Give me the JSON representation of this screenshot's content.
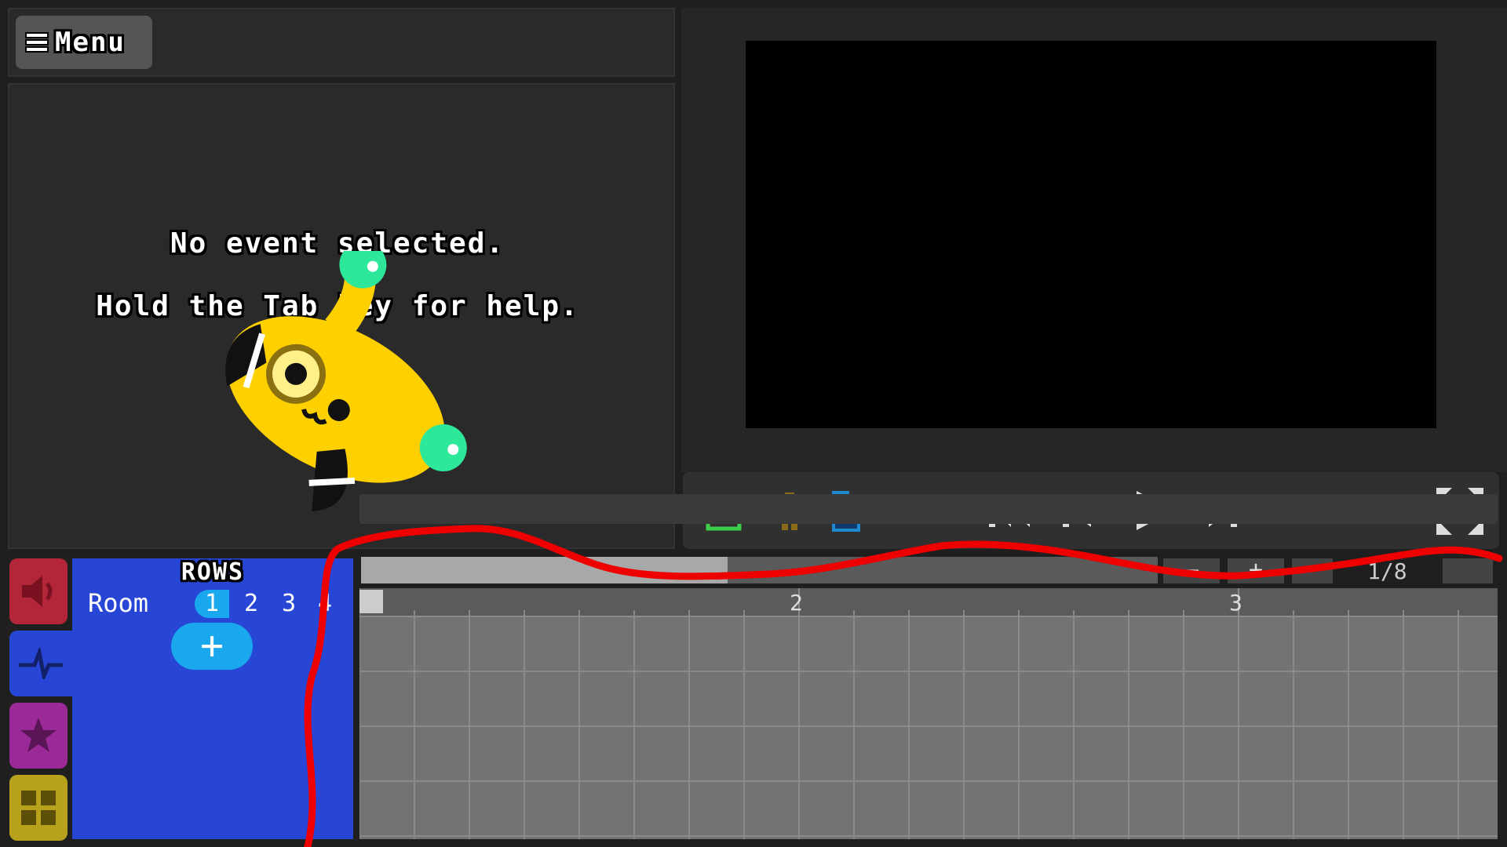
{
  "menu": {
    "label": "Menu"
  },
  "event_panel": {
    "line1": "No event selected.",
    "line2": "Hold the Tab key for help."
  },
  "controls": {
    "buttons": [
      "character-icon",
      "player-icon",
      "room-icon",
      "skip-to-start",
      "step-back",
      "play",
      "step-forward",
      "fullscreen"
    ]
  },
  "timeline": {
    "page_counter": "1/8",
    "bar_labels": [
      "2",
      "3"
    ],
    "progress": 0.46
  },
  "rows": {
    "title": "ROWS",
    "room_label": "Room",
    "rooms": [
      "1",
      "2",
      "3",
      "4"
    ],
    "selected_room": "1",
    "add_label": "+"
  },
  "colors": {
    "sound_tab": "#b3263a",
    "rows_tab": "#2846d6",
    "decor_tab": "#9b2a98",
    "grid_tab": "#b8a21c",
    "accent_blue": "#19a7ee",
    "scribble": "#ee0000"
  }
}
